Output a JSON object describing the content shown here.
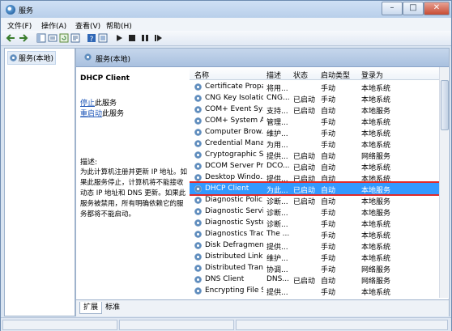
{
  "window": {
    "title": "服务",
    "min_label": "–",
    "max_label": "□",
    "close_label": "✕"
  },
  "menu": [
    "文件(F)",
    "操作(A)",
    "查看(V)",
    "帮助(H)"
  ],
  "tree": {
    "item": "服务(本地)"
  },
  "pane": {
    "title": "服务(本地)"
  },
  "details": {
    "service_name": "DHCP Client",
    "stop_link": "停止",
    "stop_rest": "此服务",
    "restart_link": "重启动",
    "restart_rest": "此服务",
    "desc_label": "描述:",
    "desc_text": "为此计算机注册并更新 IP 地址。如果此服务停止，计算机将不能接收动态 IP 地址和 DNS 更新。如果此服务被禁用，所有明确依赖它的服务都将不能启动。"
  },
  "columns": [
    "名称",
    "描述",
    "状态",
    "启动类型",
    "登录为"
  ],
  "services": [
    [
      "Certificate Propa...",
      "将用...",
      "",
      "手动",
      "本地系统"
    ],
    [
      "CNG Key Isolation",
      "CNG...",
      "已启动",
      "手动",
      "本地系统"
    ],
    [
      "COM+ Event Sys...",
      "支持...",
      "已启动",
      "自动",
      "本地服务"
    ],
    [
      "COM+ System A...",
      "管理...",
      "",
      "手动",
      "本地系统"
    ],
    [
      "Computer Brow...",
      "维护...",
      "",
      "手动",
      "本地系统"
    ],
    [
      "Credential Mana...",
      "为用...",
      "",
      "手动",
      "本地系统"
    ],
    [
      "Cryptographic Se...",
      "提供...",
      "已启动",
      "自动",
      "网络服务"
    ],
    [
      "DCOM Server Pr...",
      "DCO...",
      "已启动",
      "自动",
      "本地系统"
    ],
    [
      "Desktop Windo...",
      "提供...",
      "已启动",
      "自动",
      "本地系统"
    ],
    [
      "DHCP Client",
      "为此...",
      "已启动",
      "自动",
      "本地服务"
    ],
    [
      "Diagnostic Polic...",
      "诊断...",
      "已启动",
      "自动",
      "本地服务"
    ],
    [
      "Diagnostic Servi...",
      "诊断...",
      "",
      "手动",
      "本地服务"
    ],
    [
      "Diagnostic Syste...",
      "诊断...",
      "",
      "手动",
      "本地系统"
    ],
    [
      "Diagnostics Trac...",
      "The ...",
      "",
      "手动",
      "本地系统"
    ],
    [
      "Disk Defragmen...",
      "提供...",
      "",
      "手动",
      "本地系统"
    ],
    [
      "Distributed Link ...",
      "维护...",
      "",
      "手动",
      "本地系统"
    ],
    [
      "Distributed Tran...",
      "协调...",
      "",
      "手动",
      "网络服务"
    ],
    [
      "DNS Client",
      "DNS...",
      "已启动",
      "自动",
      "网络服务"
    ],
    [
      "Encrypting File S...",
      "提供...",
      "",
      "手动",
      "本地系统"
    ]
  ],
  "selected_index": 9,
  "tabs": [
    "扩展",
    "标准"
  ],
  "colors": {
    "selection": "#3399ff",
    "highlight_border": "#e02a2a",
    "link": "#1f57b8"
  }
}
